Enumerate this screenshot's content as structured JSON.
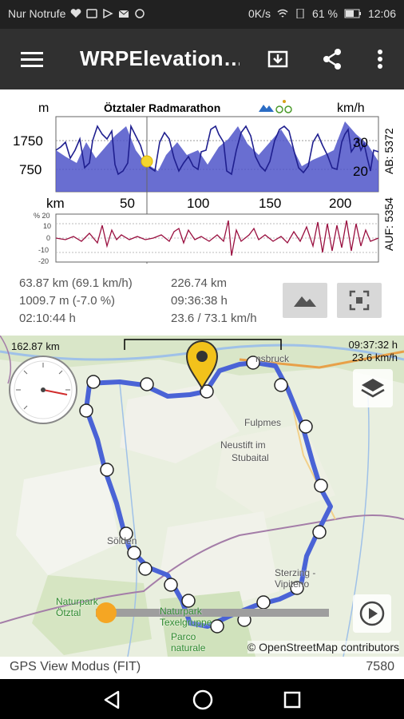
{
  "status_bar": {
    "carrier": "Nur Notrufe",
    "network": "0K/s",
    "battery": "61 %",
    "time": "12:06"
  },
  "toolbar": {
    "title": "WRPElevation…",
    "menu_icon": "hamburger-menu-icon",
    "download_icon": "download-icon",
    "share_icon": "share-icon",
    "more_icon": "more-vert-icon"
  },
  "chart": {
    "title": "Ötztaler Radmarathon",
    "left_unit": "m",
    "right_unit": "km/h",
    "x_unit": "km",
    "elev_ticks": [
      "1750",
      "750"
    ],
    "speed_ticks": [
      "30",
      "20"
    ],
    "x_ticks": [
      "50",
      "100",
      "150",
      "200"
    ],
    "ab_label": "AB: 5372",
    "auf_label": "AUF: 5354",
    "grade_ticks": [
      "% 20",
      "10",
      "0",
      "-10",
      "-20"
    ],
    "colors": {
      "elevation_fill": "#4f55c9",
      "speed_line": "#1f1f8f",
      "grade_line": "#9a1040",
      "marker": "#f2d530"
    }
  },
  "stats": {
    "row1_left": "63.87 km (69.1 km/h)",
    "row2_left": "1009.7 m (-7.0 %)",
    "row3_left": "02:10:44 h",
    "row1_right": "226.74 km",
    "row2_right": "09:36:38 h",
    "row3_right": "23.6 / 73.1 km/h",
    "mountain_button_icon": "mountain-icon",
    "fit_button_icon": "fit-screen-icon"
  },
  "map": {
    "distance": "162.87 km",
    "time": "09:37:32 h",
    "speed": "23.6 km/h",
    "places": [
      "nsbruck",
      "Fulpmes",
      "Neustift im",
      "Stubaital",
      "Sölden",
      "Sterzing - Vipiteno",
      "Naturpark Ötztal",
      "Naturpark Texelgruppe",
      "Parco naturale"
    ],
    "attribution": "© OpenStreetMap contributors",
    "layers_icon": "layers-icon",
    "play_icon": "play-icon",
    "gauge_icon": "speedometer-icon",
    "pin_icon": "location-pin-icon",
    "colors": {
      "route": "#4a63d6",
      "pin": "#f2c21b",
      "slider": "#f5a623"
    }
  },
  "footer": {
    "mode": "GPS View Modus (FIT)",
    "count": "7580"
  },
  "navbar": {
    "back_icon": "back-triangle-icon",
    "home_icon": "home-circle-icon",
    "recents_icon": "recents-square-icon"
  }
}
